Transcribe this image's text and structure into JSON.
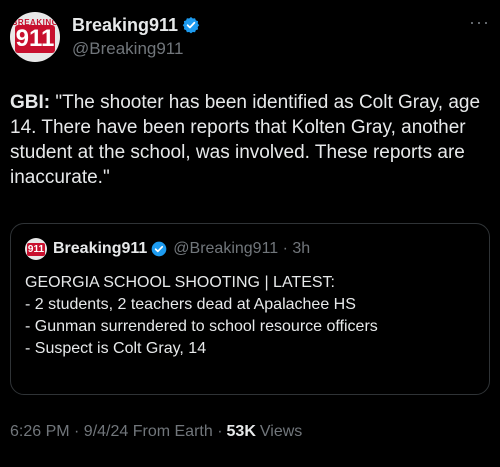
{
  "author": {
    "display_name": "Breaking911",
    "handle": "@Breaking911",
    "avatar_top_text": "BREAKING",
    "avatar_number": "911",
    "more_label": "···"
  },
  "post": {
    "lead": "GBI:",
    "text": " \"The shooter has been identified as Colt Gray, age 14. There have been reports that Kolten Gray, another student at the school, was involved. These reports are inaccurate.\""
  },
  "quoted": {
    "display_name": "Breaking911",
    "handle_time": "@Breaking911 · 3h",
    "avatar_number": "911",
    "lines": [
      "GEORGIA SCHOOL SHOOTING | LATEST:",
      "",
      "- 2 students, 2 teachers dead at Apalachee HS",
      "- Gunman surrendered to school resource officers",
      "- Suspect is Colt Gray, 14"
    ]
  },
  "meta": {
    "timestamp": "6:26 PM · 9/4/24 From Earth ·",
    "views_count": "53K",
    "views_label": "Views"
  },
  "colors": {
    "background": "#000000",
    "text": "#e7e9ea",
    "muted": "#71767b",
    "verified": "#1d9bf0",
    "brand_red": "#c8102e"
  }
}
